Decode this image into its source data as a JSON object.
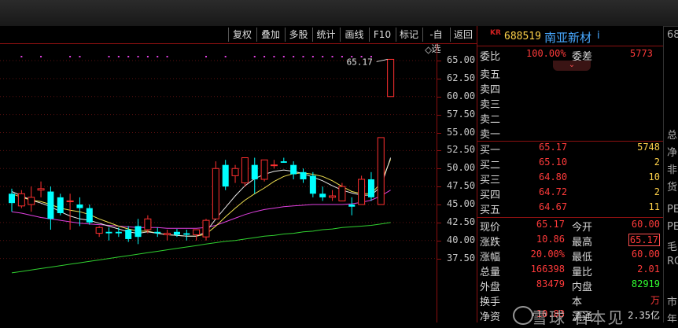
{
  "toolbar": {
    "buttons": [
      "复权",
      "叠加",
      "多股",
      "统计",
      "画线",
      "F10",
      "标记",
      "-自选",
      "返回"
    ]
  },
  "header": {
    "badge": "KR",
    "code": "688519",
    "name": "南亚新材",
    "info": "i"
  },
  "chart_data": {
    "type": "candlestick",
    "ylim": [
      37.5,
      66.0
    ],
    "y_ticks": [
      "65.00",
      "62.50",
      "60.00",
      "57.50",
      "55.00",
      "52.50",
      "50.00",
      "47.50",
      "45.00",
      "42.50",
      "40.00",
      "37.50"
    ],
    "y_tick_values": [
      65.0,
      62.5,
      60.0,
      57.5,
      55.0,
      52.5,
      50.0,
      47.5,
      45.0,
      42.5,
      40.0,
      37.5
    ],
    "annotation": "65.17",
    "candles": [
      {
        "o": 46.5,
        "h": 47.2,
        "l": 44.0,
        "c": 45.2
      },
      {
        "o": 44.8,
        "h": 47.0,
        "l": 44.5,
        "c": 46.5
      },
      {
        "o": 45.0,
        "h": 47.5,
        "l": 44.0,
        "c": 46.0
      },
      {
        "o": 47.0,
        "h": 48.2,
        "l": 46.0,
        "c": 47.2
      },
      {
        "o": 46.8,
        "h": 47.5,
        "l": 41.5,
        "c": 43.0
      },
      {
        "o": 46.0,
        "h": 46.5,
        "l": 43.5,
        "c": 43.8
      },
      {
        "o": 45.5,
        "h": 46.5,
        "l": 41.5,
        "c": 45.5
      },
      {
        "o": 45.0,
        "h": 46.0,
        "l": 42.0,
        "c": 44.5
      },
      {
        "o": 44.5,
        "h": 45.0,
        "l": 42.2,
        "c": 42.5
      },
      {
        "o": 41.0,
        "h": 42.0,
        "l": 40.5,
        "c": 41.8
      },
      {
        "o": 41.2,
        "h": 41.8,
        "l": 40.0,
        "c": 41.0
      },
      {
        "o": 41.2,
        "h": 41.8,
        "l": 40.5,
        "c": 41.0
      },
      {
        "o": 41.5,
        "h": 42.0,
        "l": 39.8,
        "c": 40.2
      },
      {
        "o": 42.0,
        "h": 43.0,
        "l": 39.5,
        "c": 40.5
      },
      {
        "o": 41.5,
        "h": 43.5,
        "l": 41.0,
        "c": 43.0
      },
      {
        "o": 41.2,
        "h": 41.8,
        "l": 40.5,
        "c": 41.0
      },
      {
        "o": 40.8,
        "h": 41.5,
        "l": 40.0,
        "c": 41.0
      },
      {
        "o": 41.2,
        "h": 41.6,
        "l": 40.5,
        "c": 40.8
      },
      {
        "o": 41.0,
        "h": 41.5,
        "l": 40.0,
        "c": 40.8
      },
      {
        "o": 40.8,
        "h": 41.5,
        "l": 40.0,
        "c": 41.5
      },
      {
        "o": 40.5,
        "h": 43.0,
        "l": 40.0,
        "c": 42.8
      },
      {
        "o": 43.0,
        "h": 51.0,
        "l": 43.0,
        "c": 50.0
      },
      {
        "o": 50.5,
        "h": 51.2,
        "l": 47.0,
        "c": 47.5
      },
      {
        "o": 49.0,
        "h": 50.5,
        "l": 48.0,
        "c": 50.0
      },
      {
        "o": 48.0,
        "h": 51.5,
        "l": 47.5,
        "c": 51.5
      },
      {
        "o": 50.5,
        "h": 51.5,
        "l": 46.5,
        "c": 48.5
      },
      {
        "o": 48.5,
        "h": 51.0,
        "l": 48.2,
        "c": 51.2
      },
      {
        "o": 50.5,
        "h": 51.2,
        "l": 50.0,
        "c": 50.5
      },
      {
        "o": 51.0,
        "h": 51.5,
        "l": 50.8,
        "c": 50.8
      },
      {
        "o": 50.5,
        "h": 51.0,
        "l": 48.5,
        "c": 49.2
      },
      {
        "o": 49.5,
        "h": 50.0,
        "l": 48.0,
        "c": 48.5
      },
      {
        "o": 49.0,
        "h": 49.5,
        "l": 46.0,
        "c": 46.5
      },
      {
        "o": 46.5,
        "h": 47.5,
        "l": 45.5,
        "c": 46.0
      },
      {
        "o": 46.0,
        "h": 47.0,
        "l": 45.5,
        "c": 46.2
      },
      {
        "o": 45.5,
        "h": 48.0,
        "l": 45.5,
        "c": 47.5
      },
      {
        "o": 45.0,
        "h": 46.0,
        "l": 43.5,
        "c": 44.7
      },
      {
        "o": 45.0,
        "h": 49.0,
        "l": 45.0,
        "c": 48.5
      },
      {
        "o": 48.5,
        "h": 49.5,
        "l": 45.5,
        "c": 46.0
      },
      {
        "o": 45.0,
        "h": 54.3,
        "l": 45.0,
        "c": 54.3
      },
      {
        "o": 60.0,
        "h": 65.17,
        "l": 60.0,
        "c": 65.17
      }
    ],
    "ma_yellow": [
      46.5,
      46.0,
      45.6,
      45.4,
      45.0,
      44.5,
      44.2,
      44.0,
      43.6,
      43.0,
      42.5,
      42.0,
      41.6,
      41.3,
      41.3,
      41.0,
      40.8,
      40.7,
      40.6,
      40.6,
      40.9,
      42.0,
      43.3,
      44.5,
      45.6,
      46.5,
      47.3,
      48.2,
      48.9,
      49.3,
      49.4,
      49.2,
      48.9,
      48.3,
      47.5,
      46.8,
      46.5,
      46.5,
      48.0,
      51.3
    ],
    "ma_white": [
      46.8,
      46.2,
      45.6,
      45.2,
      44.7,
      44.0,
      43.4,
      43.0,
      42.8,
      42.4,
      42.0,
      41.6,
      41.2,
      41.0,
      41.2,
      41.0,
      40.8,
      40.7,
      40.6,
      40.6,
      41.2,
      43.0,
      44.6,
      46.2,
      47.6,
      48.6,
      49.2,
      49.6,
      49.8,
      49.6,
      49.3,
      48.8,
      48.3,
      47.6,
      47.0,
      46.6,
      46.3,
      46.3,
      47.5,
      51.5
    ],
    "ma_magenta": [
      44.0,
      43.8,
      43.5,
      43.2,
      43.0,
      42.8,
      42.6,
      42.4,
      42.3,
      42.2,
      42.1,
      42.0,
      41.9,
      41.8,
      41.8,
      41.8,
      41.7,
      41.7,
      41.7,
      41.7,
      41.8,
      42.1,
      42.6,
      43.1,
      43.6,
      44.0,
      44.3,
      44.5,
      44.7,
      44.8,
      44.9,
      45.0,
      45.0,
      45.0,
      45.0,
      45.1,
      45.3,
      45.6,
      46.2,
      47.0
    ],
    "ma_green": [
      35.5,
      35.7,
      35.9,
      36.1,
      36.3,
      36.5,
      36.7,
      36.9,
      37.1,
      37.3,
      37.5,
      37.7,
      37.9,
      38.1,
      38.3,
      38.5,
      38.7,
      38.9,
      39.1,
      39.3,
      39.5,
      39.7,
      39.9,
      40.0,
      40.2,
      40.4,
      40.6,
      40.7,
      40.9,
      41.0,
      41.2,
      41.3,
      41.5,
      41.6,
      41.8,
      41.9,
      42.0,
      42.1,
      42.3,
      42.5
    ]
  },
  "panel": {
    "weibi_label": "委比",
    "weibi": "100.00%",
    "weicha_label": "委差",
    "weicha": "5773",
    "sells": [
      "卖五",
      "卖四",
      "卖三",
      "卖二",
      "卖一"
    ],
    "buys": [
      {
        "label": "买一",
        "price": "65.17",
        "vol": "5748"
      },
      {
        "label": "买二",
        "price": "65.10",
        "vol": "2"
      },
      {
        "label": "买三",
        "price": "64.80",
        "vol": "10"
      },
      {
        "label": "买四",
        "price": "64.72",
        "vol": "2"
      },
      {
        "label": "买五",
        "price": "64.67",
        "vol": "11"
      }
    ],
    "stats": [
      {
        "l1": "现价",
        "v1": "65.17",
        "l2": "今开",
        "v2": "60.00"
      },
      {
        "l1": "涨跌",
        "v1": "10.86",
        "l2": "最高",
        "v2": "65.17"
      },
      {
        "l1": "涨幅",
        "v1": "20.00%",
        "l2": "最低",
        "v2": "60.00"
      },
      {
        "l1": "总量",
        "v1": "166398",
        "l2": "量比",
        "v2": "2.01"
      },
      {
        "l1": "外盘",
        "v1": "83479",
        "l2": "内盘",
        "v2": "82919"
      },
      {
        "l1": "换手",
        "v1": "",
        "l2": "本",
        "v2": "万"
      },
      {
        "l1": "净资",
        "v1": "10.83",
        "l2": "流通",
        "v2": "2.35亿"
      }
    ]
  },
  "right_edge": [
    "68",
    "总",
    "净",
    "非",
    "货",
    "PE",
    "PE",
    "毛",
    "RO",
    "市",
    "年"
  ],
  "watermark": "雪球 石本见",
  "colors": {
    "up": "#ff3030",
    "down": "#00ffff",
    "ma_yellow": "#f0e050",
    "ma_white": "#e8e8e8",
    "ma_magenta": "#e040e0",
    "ma_green": "#30d030"
  }
}
